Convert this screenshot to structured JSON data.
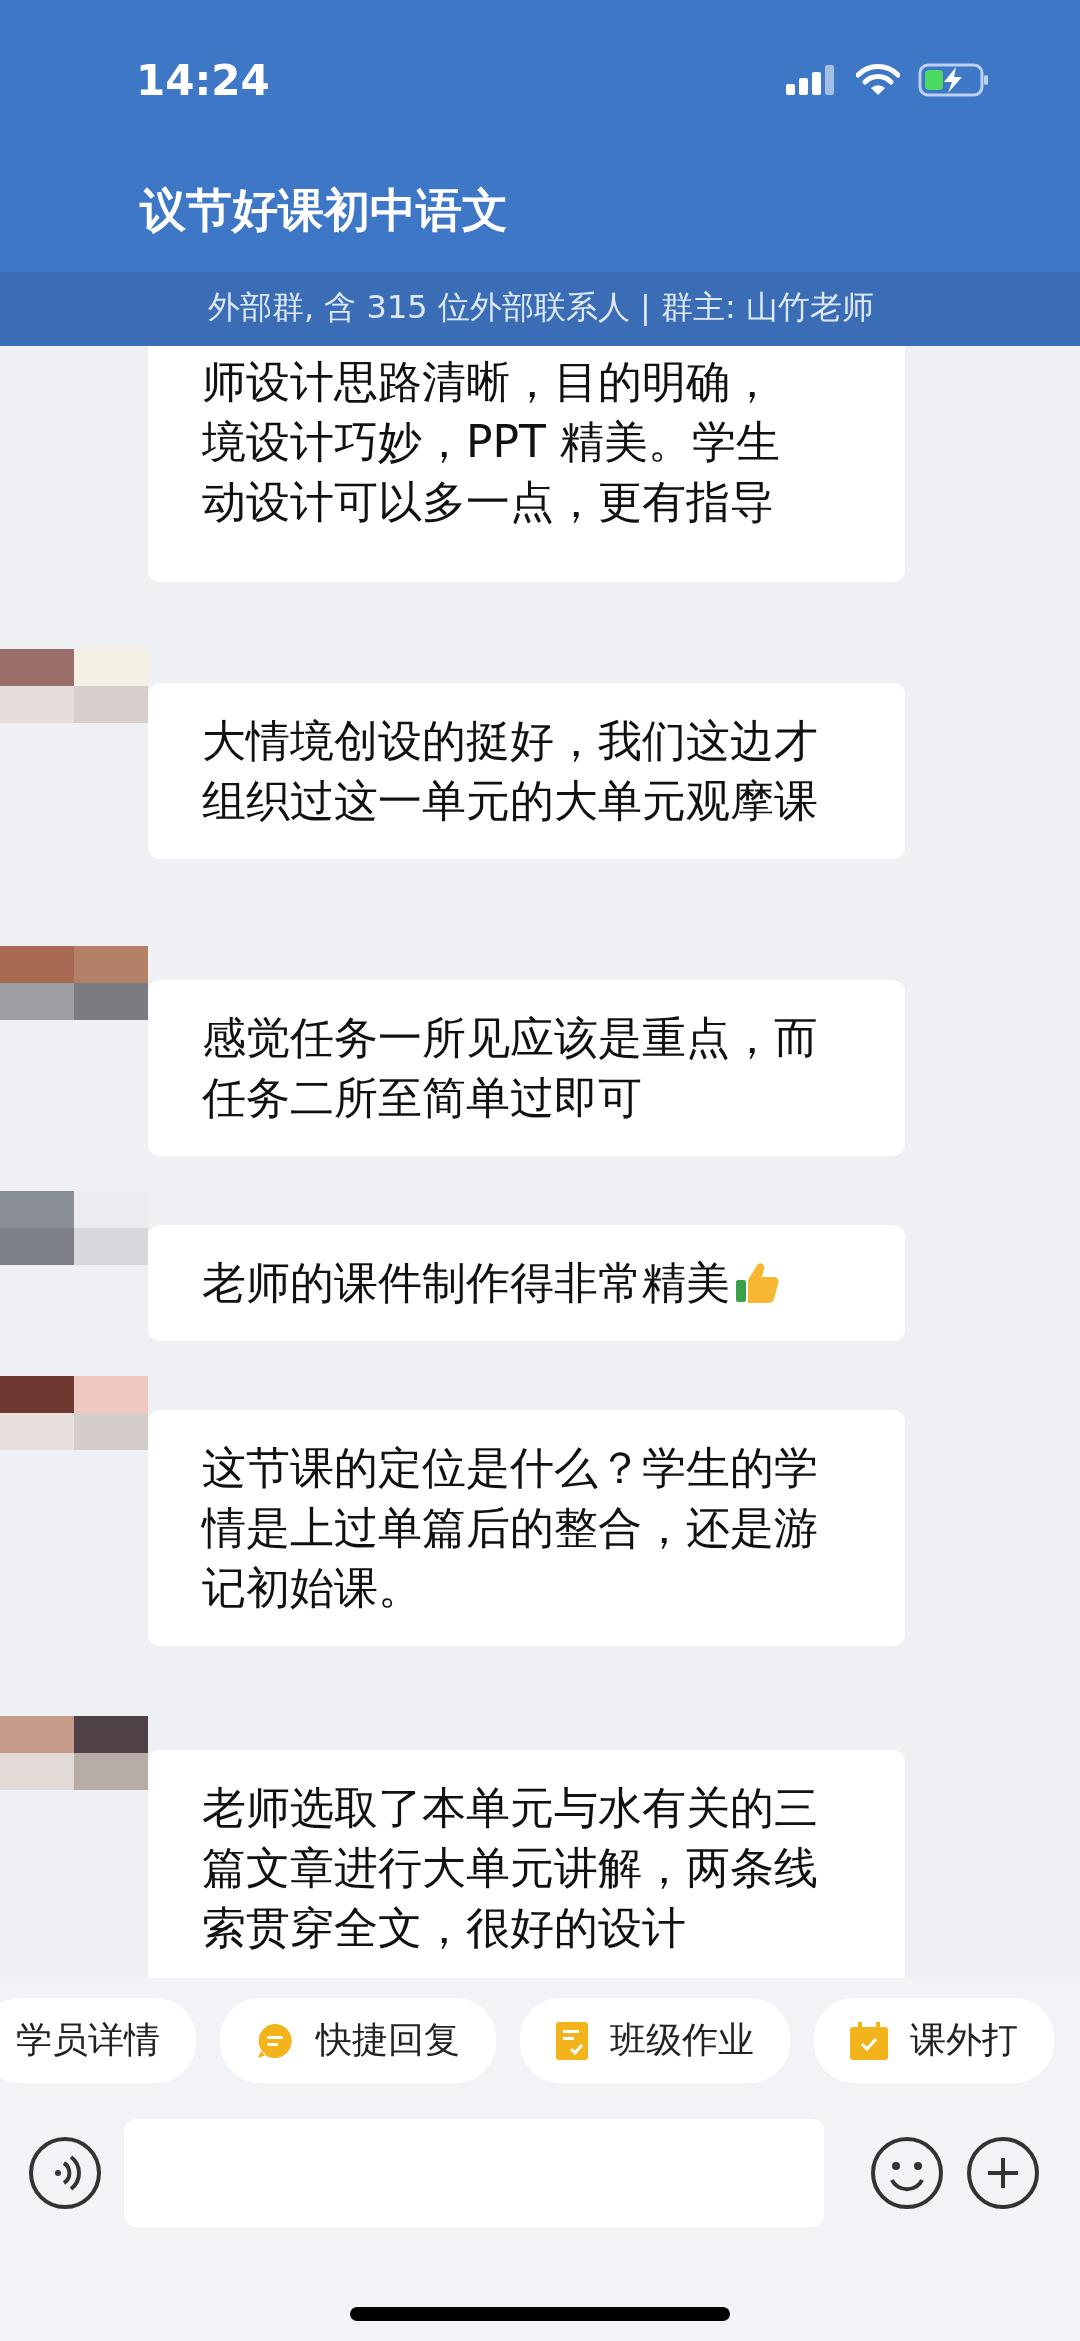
{
  "status_bar": {
    "time": "14:24"
  },
  "header": {
    "title": "议节好课初中语文",
    "subtitle": "外部群, 含 315 位外部联系人 | 群主: 山竹老师"
  },
  "messages": [
    {
      "kind": "text",
      "lines": [
        "师设计思路清晰，目的明确，",
        "境设计巧妙，PPT 精美。学生",
        "动设计可以多一点，更有指导"
      ]
    },
    {
      "kind": "text",
      "lines": [
        "大情境创设的挺好，我们这边才",
        "组织过这一单元的大单元观摩课"
      ]
    },
    {
      "kind": "text",
      "lines": [
        "感觉任务一所见应该是重点，而",
        "任务二所至简单过即可"
      ]
    },
    {
      "kind": "text_with_emoji",
      "lines": [
        "老师的课件制作得非常精美"
      ]
    },
    {
      "kind": "text",
      "lines": [
        "这节课的定位是什么？学生的学",
        "情是上过单篇后的整合，还是游",
        "记初始课。"
      ]
    },
    {
      "kind": "text",
      "lines": [
        "老师选取了本单元与水有关的三",
        "篇文章进行大单元讲解，两条线",
        "索贯穿全文，很好的设计"
      ]
    }
  ],
  "quick_actions": [
    {
      "label": "学员详情"
    },
    {
      "label": "快捷回复"
    },
    {
      "label": "班级作业"
    },
    {
      "label": "课外打"
    }
  ]
}
